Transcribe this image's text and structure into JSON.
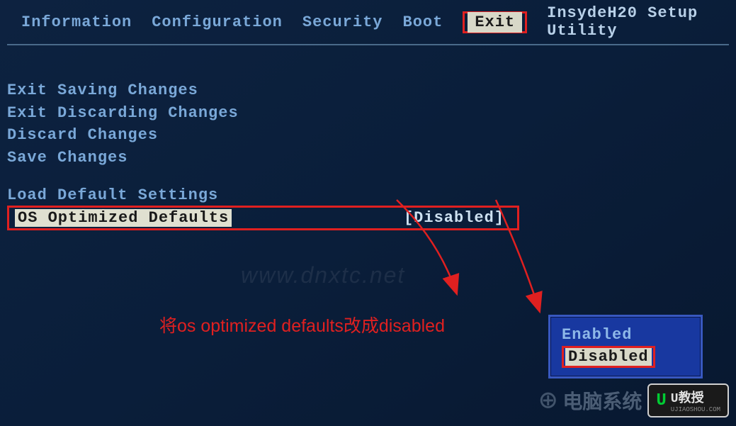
{
  "utility_name": "InsydeH20 Setup Utility",
  "menu": {
    "items": [
      {
        "label": "Information",
        "active": false
      },
      {
        "label": "Configuration",
        "active": false
      },
      {
        "label": "Security",
        "active": false
      },
      {
        "label": "Boot",
        "active": false
      },
      {
        "label": "Exit",
        "active": true
      }
    ]
  },
  "exit_options": [
    "Exit Saving Changes",
    "Exit Discarding Changes",
    "Discard Changes",
    "Save Changes"
  ],
  "settings_options": [
    "Load Default Settings"
  ],
  "os_optimized": {
    "label": "OS Optimized Defaults",
    "value": "[Disabled]"
  },
  "popup": {
    "options": [
      {
        "label": "Enabled",
        "selected": false
      },
      {
        "label": "Disabled",
        "selected": true
      }
    ]
  },
  "annotation": "将os optimized defaults改成disabled",
  "watermark": "www.dnxtc.net",
  "logo": {
    "u": "U",
    "name": "U教授",
    "sub": "UJIAOSHOU.COM",
    "chinese": "电脑系统"
  }
}
